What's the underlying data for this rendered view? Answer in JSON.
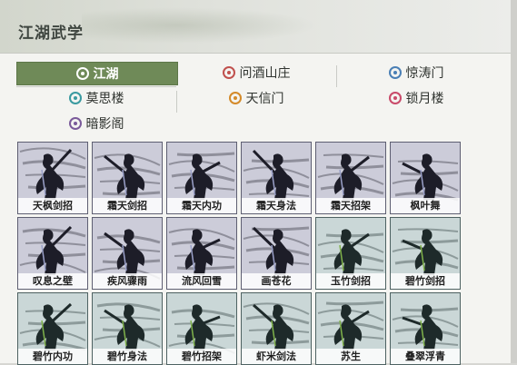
{
  "header": {
    "title": "江湖武学"
  },
  "tabs": [
    {
      "label": "江湖",
      "active": true,
      "icon": "jianghu-emblem-icon",
      "icon_color": "#ffffff"
    },
    {
      "label": "问酒山庄",
      "active": false,
      "icon": "wenjiu-emblem-icon",
      "icon_color": "#c0504d"
    },
    {
      "label": "惊涛门",
      "active": false,
      "icon": "jingtao-emblem-icon",
      "icon_color": "#4a7fb5"
    },
    {
      "label": "莫思楼",
      "active": false,
      "icon": "mosi-emblem-icon",
      "icon_color": "#3a9aa0"
    },
    {
      "label": "天信门",
      "active": false,
      "icon": "tianxin-emblem-icon",
      "icon_color": "#d48a2a"
    },
    {
      "label": "锁月楼",
      "active": false,
      "icon": "suoyue-emblem-icon",
      "icon_color": "#c94a6a"
    },
    {
      "label": "暗影阁",
      "active": false,
      "icon": "anying-emblem-icon",
      "icon_color": "#7a5a9a"
    }
  ],
  "skills": [
    {
      "name": "天枫剑招",
      "style": "purple"
    },
    {
      "name": "霜天剑招",
      "style": "purple"
    },
    {
      "name": "霜天内功",
      "style": "purple"
    },
    {
      "name": "霜天身法",
      "style": "purple"
    },
    {
      "name": "霜天招架",
      "style": "purple"
    },
    {
      "name": "枫叶舞",
      "style": "purple"
    },
    {
      "name": "叹息之壁",
      "style": "purple"
    },
    {
      "name": "疾风骤雨",
      "style": "purple"
    },
    {
      "name": "流风回雪",
      "style": "purple"
    },
    {
      "name": "画苍花",
      "style": "purple"
    },
    {
      "name": "玉竹剑招",
      "style": "green"
    },
    {
      "name": "碧竹剑招",
      "style": "green"
    },
    {
      "name": "碧竹内功",
      "style": "green"
    },
    {
      "name": "碧竹身法",
      "style": "green"
    },
    {
      "name": "碧竹招架",
      "style": "green"
    },
    {
      "name": "虾米剑法",
      "style": "green"
    },
    {
      "name": "苏生",
      "style": "green"
    },
    {
      "name": "叠翠浮青",
      "style": "green"
    }
  ]
}
